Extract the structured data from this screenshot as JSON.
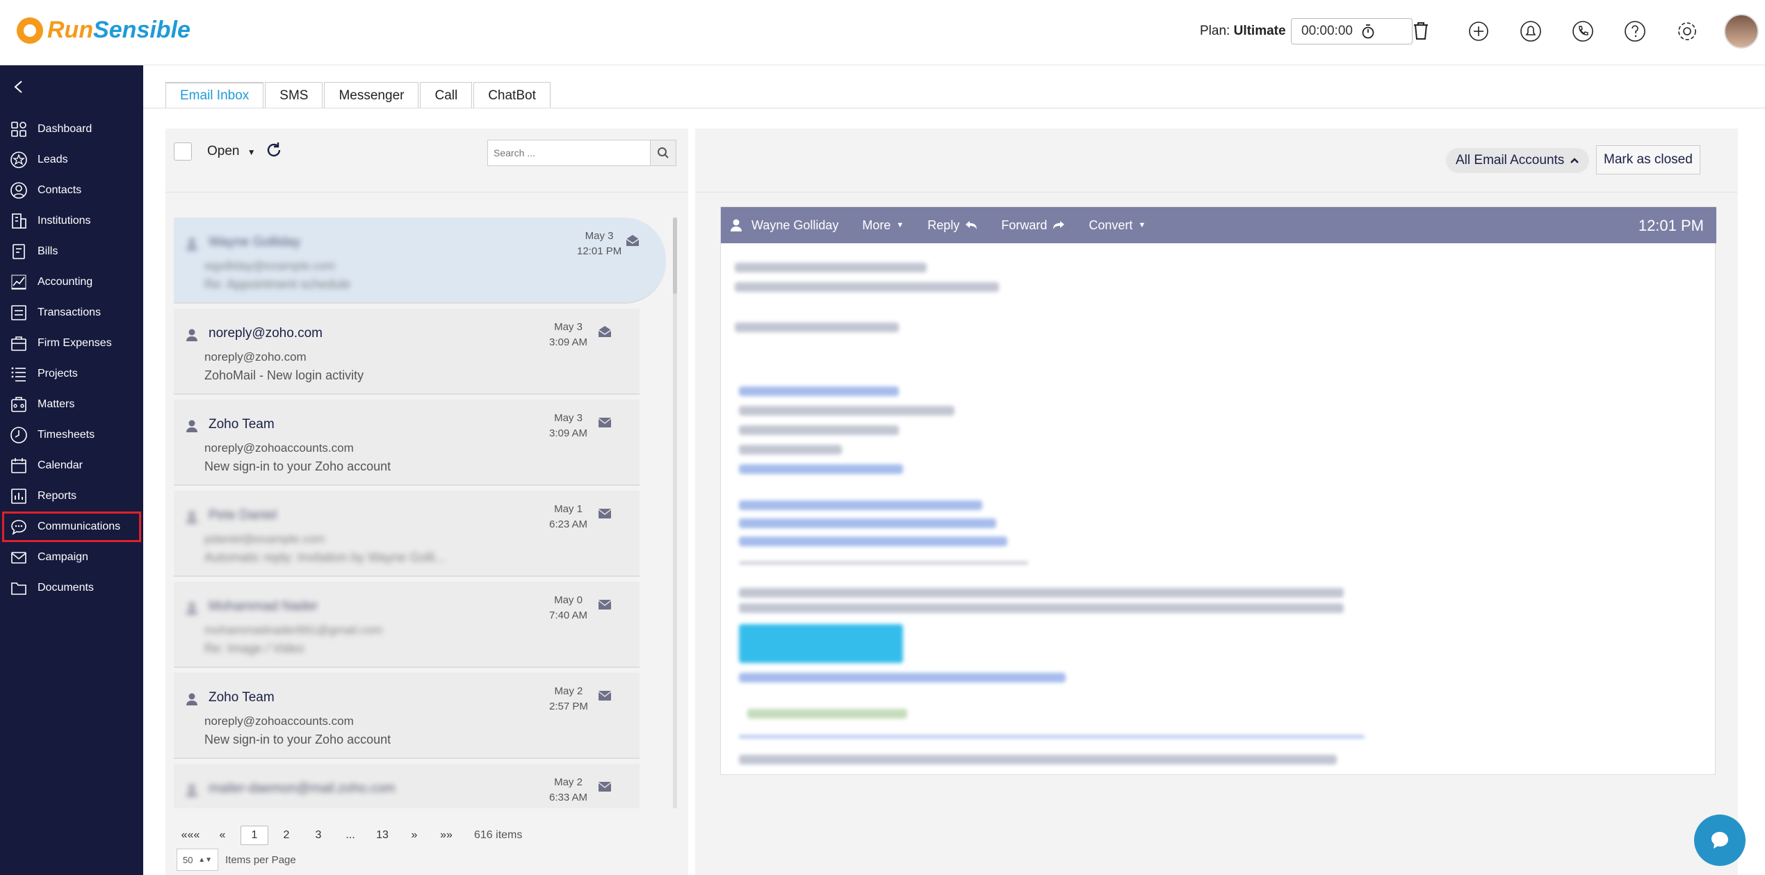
{
  "app": {
    "logo_part1": "Run",
    "logo_part2": "Sensible"
  },
  "header": {
    "plan_label": "Plan:",
    "plan_value": "Ultimate",
    "timer": "00:00:00"
  },
  "sidebar": {
    "items": [
      {
        "label": "Dashboard",
        "icon": "dashboard-icon"
      },
      {
        "label": "Leads",
        "icon": "star-icon"
      },
      {
        "label": "Contacts",
        "icon": "contact-icon"
      },
      {
        "label": "Institutions",
        "icon": "building-icon"
      },
      {
        "label": "Bills",
        "icon": "bill-icon"
      },
      {
        "label": "Accounting",
        "icon": "accounting-icon"
      },
      {
        "label": "Transactions",
        "icon": "transactions-icon"
      },
      {
        "label": "Firm Expenses",
        "icon": "expenses-icon"
      },
      {
        "label": "Projects",
        "icon": "projects-icon"
      },
      {
        "label": "Matters",
        "icon": "matters-icon"
      },
      {
        "label": "Timesheets",
        "icon": "clock-icon"
      },
      {
        "label": "Calendar",
        "icon": "calendar-icon"
      },
      {
        "label": "Reports",
        "icon": "reports-icon"
      },
      {
        "label": "Communications",
        "icon": "chat-icon",
        "active": true
      },
      {
        "label": "Campaign",
        "icon": "mail-icon"
      },
      {
        "label": "Documents",
        "icon": "folder-icon"
      }
    ]
  },
  "tabs": [
    "Email Inbox",
    "SMS",
    "Messenger",
    "Call",
    "ChatBot"
  ],
  "list": {
    "status_filter": "Open",
    "search_placeholder": "Search ...",
    "messages": [
      {
        "sender": "Wayne Golliday",
        "email": "wgolliday@example.com",
        "subject": "Re: Appointment schedule",
        "date": "May 3",
        "time": "12:01 PM",
        "blurred": true,
        "opened": true
      },
      {
        "sender": "noreply@zoho.com",
        "email": "noreply@zoho.com",
        "subject": "ZohoMail - New login activity",
        "date": "May 3",
        "time": "3:09 AM",
        "blurred": false,
        "opened": true
      },
      {
        "sender": "Zoho Team",
        "email": "noreply@zohoaccounts.com",
        "subject": "New sign-in to your Zoho account",
        "date": "May 3",
        "time": "3:09 AM",
        "blurred": false,
        "opened": false
      },
      {
        "sender": "Pete Daniel",
        "email": "pdaniel@example.com",
        "subject": "Automatic reply: Invitation by Wayne Golli...",
        "date": "May 1",
        "time": "6:23 AM",
        "blurred": true,
        "opened": false
      },
      {
        "sender": "Mohammad Nader",
        "email": "mohammadnader891@gmail.com",
        "subject": "Re: Image / Video",
        "date": "May 0",
        "time": "7:40 AM",
        "blurred": true,
        "opened": false
      },
      {
        "sender": "Zoho Team",
        "email": "noreply@zohoaccounts.com",
        "subject": "New sign-in to your Zoho account",
        "date": "May 2",
        "time": "2:57 PM",
        "blurred": false,
        "opened": false
      },
      {
        "sender": "mailer-daemon@mail.zoho.com",
        "email": "",
        "subject": "",
        "date": "May 2",
        "time": "6:33 AM",
        "blurred": true,
        "opened": false
      }
    ],
    "pagination": {
      "first": "«««",
      "prev": "«",
      "pages": [
        "1",
        "2",
        "3",
        "...",
        "13"
      ],
      "current": "1",
      "next": "»",
      "last": "»»",
      "items_total": "616 items"
    },
    "per_page_value": "50",
    "per_page_label": "Items per Page"
  },
  "detail": {
    "accounts_button": "All Email Accounts",
    "close_button": "Mark as closed",
    "sender": "Wayne Golliday",
    "actions": [
      "More",
      "Reply",
      "Forward",
      "Convert"
    ],
    "time": "12:01 PM"
  },
  "colors": {
    "sidebar_bg": "#161a3d",
    "accent_blue": "#1f9bd7",
    "brand_orange": "#f59a1b",
    "email_header": "#7c7fa4",
    "active_outline": "#e0202a"
  }
}
